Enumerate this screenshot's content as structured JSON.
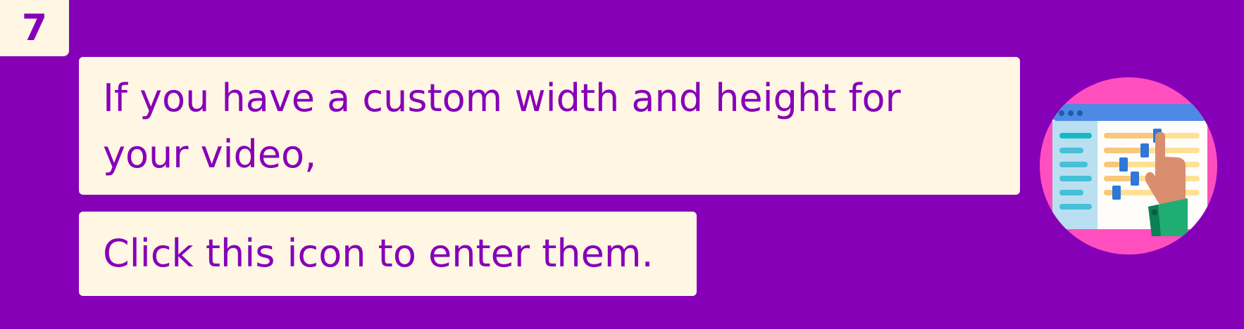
{
  "step": {
    "number": "7"
  },
  "instructions": {
    "line_1": "If you have a custom width and height for your video,",
    "line_2": "Click this icon to enter them."
  },
  "illustration": {
    "icon": "settings-sliders-window-hand-icon"
  },
  "colors": {
    "background": "#8600b8",
    "panel": "#fff6e4",
    "text": "#8600b8",
    "icon_circle": "#ff4fbf"
  }
}
